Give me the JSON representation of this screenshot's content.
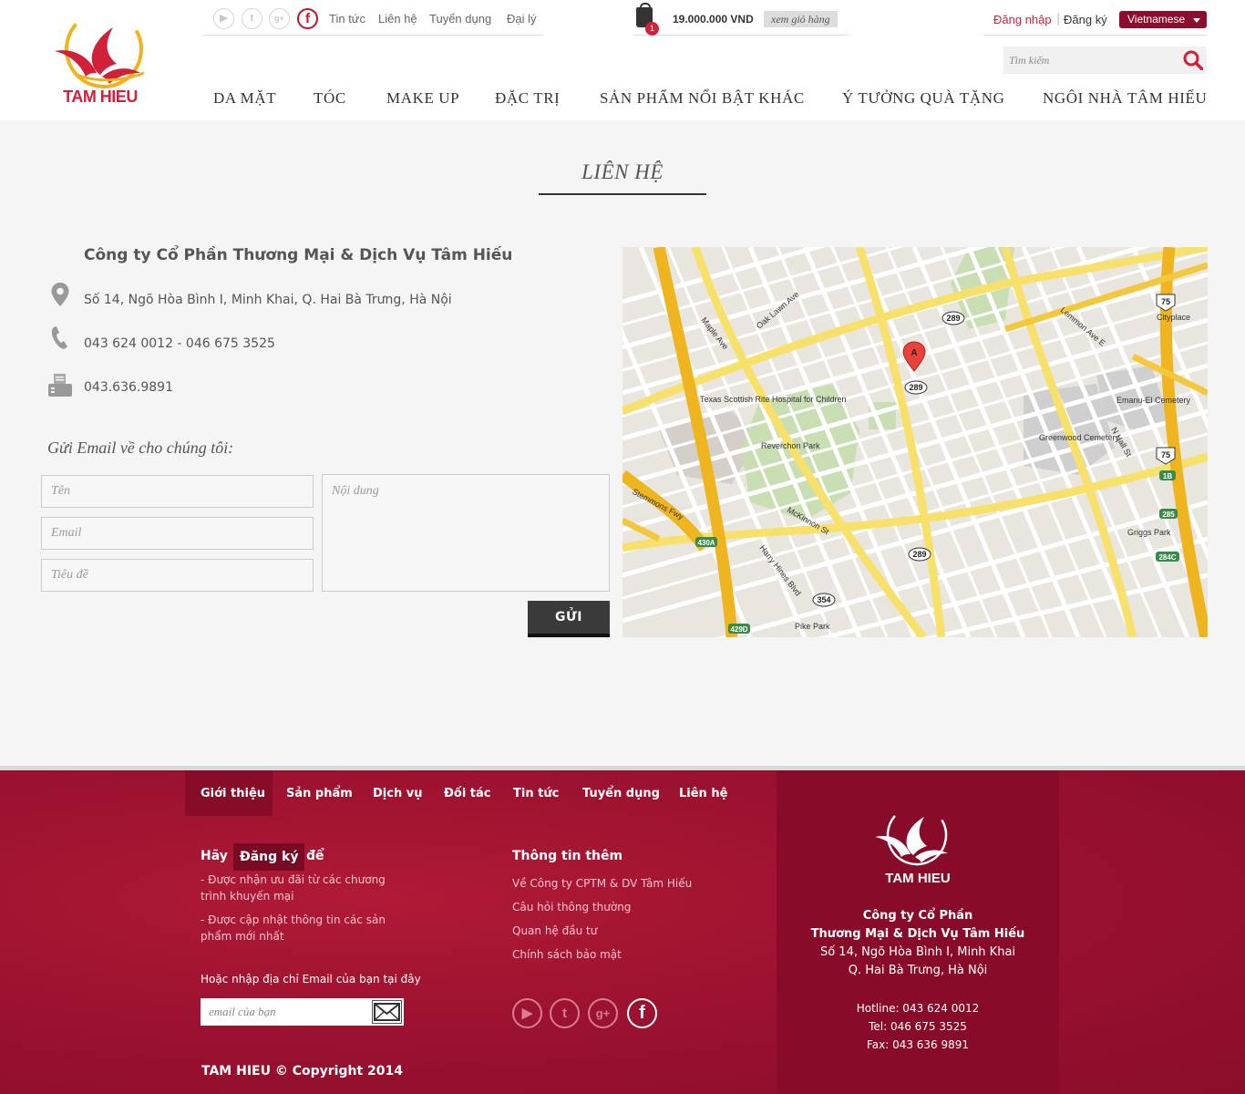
{
  "header": {
    "logo_text": "TAM HIEU",
    "social": [
      "youtube-icon",
      "twitter-icon",
      "google-plus-icon",
      "facebook-icon"
    ],
    "top_links": [
      "Tin tức",
      "Liên hệ",
      "Tuyển dụng",
      "Đại lý"
    ],
    "cart": {
      "count": "1",
      "total": "19.000.000 VND",
      "view_label": "xem giỏ hàng"
    },
    "login_label": "Đăng nhập",
    "separator": "|",
    "register_label": "Đăng ký",
    "language": "Vietnamese",
    "search_placeholder": "Tìm kiếm",
    "nav": [
      "DA MẶT",
      "TÓC",
      "MAKE UP",
      "ĐẶC TRỊ",
      "SẢN PHẨM NỔI BẬT KHÁC",
      "Ý TƯỞNG QUÀ TẶNG",
      "NGÔI NHÀ TÂM HIẾU"
    ]
  },
  "page": {
    "title": "LIÊN HỆ"
  },
  "contact": {
    "company": "Công ty Cổ Phần Thương Mại & Dịch Vụ Tâm Hiếu",
    "address": "Số 14, Ngõ Hòa Bình I, Minh Khai, Q. Hai Bà Trưng, Hà Nội",
    "phone": "043 624 0012 - 046 675 3525",
    "fax": "043.636.9891"
  },
  "form": {
    "title": "Gửi Email về cho chúng tôi:",
    "name_placeholder": "Tên",
    "email_placeholder": "Email",
    "subject_placeholder": "Tiêu đề",
    "content_placeholder": "Nội dung",
    "send_label": "GỬI"
  },
  "map": {
    "labels": [
      "Texas Scottish Rite Hospital for Children",
      "Reverchon Park",
      "Greenwood Cemetery",
      "Emanu-El Cemetery",
      "Cityplace",
      "Griggs Park",
      "Pike Park",
      "Stemmons Fwy",
      "Maple Ave",
      "Oak Lawn Ave",
      "McKinnon St",
      "Harry Hines Blvd",
      "Lemmon Ave E",
      "N Hall St"
    ],
    "shields": [
      "289",
      "289",
      "289",
      "75",
      "75",
      "354",
      "430A",
      "429D",
      "285",
      "284C",
      "1B"
    ],
    "marker": "A"
  },
  "footer": {
    "nav": [
      "Giới thiệu",
      "Sản phẩm",
      "Dịch vụ",
      "Đối tác",
      "Tin tức",
      "Tuyển dụng",
      "Liên hệ"
    ],
    "subscribe_prefix": "Hãy",
    "subscribe_link": "Đăng ký",
    "subscribe_suffix": "để",
    "benefits": [
      "- Được nhận ưu đãi từ các chương trình khuyến mại",
      "- Được cập nhật thông tin các sản phẩm mới nhất"
    ],
    "email_prompt": "Hoặc nhập địa chỉ Email của bạn tại đây",
    "email_placeholder": "email của bạn",
    "more_title": "Thông tin thêm",
    "more_links": [
      "Về Công ty CPTM & DV Tâm Hiếu",
      "Câu hỏi thông thường",
      "Quan hệ đầu tư",
      "Chính sách bảo mật"
    ],
    "social": [
      "youtube-icon",
      "twitter-icon",
      "google-plus-icon",
      "facebook-icon"
    ],
    "copyright": "TAM HIEU © Copyright 2014",
    "logo_text": "TAM HIEU",
    "company_line1": "Công ty Cổ Phần",
    "company_line2": "Thương Mại & Dịch Vụ Tâm Hiếu",
    "address_line1": "Số 14, Ngõ Hòa Bình I, Minh Khai",
    "address_line2": "Q. Hai Bà Trưng, Hà Nội",
    "hotline": "Hotline: 043 624 0012",
    "tel": "Tel: 046 675 3525",
    "fax": "Fax: 043 636 9891"
  },
  "colors": {
    "brand": "#d0203a",
    "footer": "#a3122f",
    "dark": "#333333"
  }
}
